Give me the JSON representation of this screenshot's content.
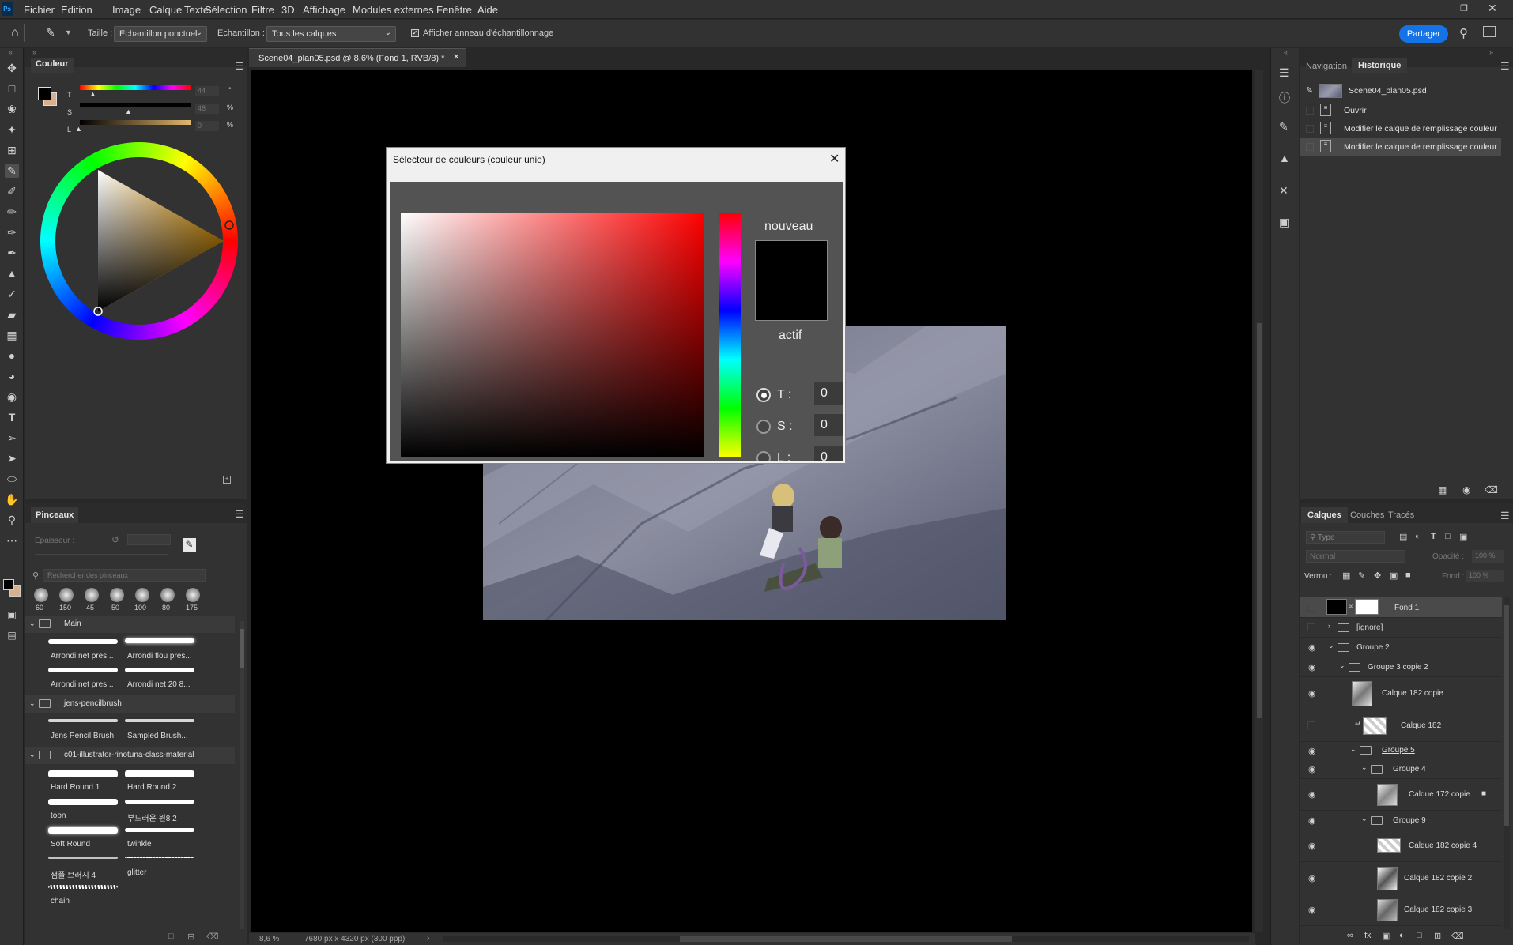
{
  "menubar": {
    "logo": "Ps",
    "items": [
      "Fichier",
      "Edition",
      "Image",
      "Calque",
      "Texte",
      "Sélection",
      "Filtre",
      "3D",
      "Affichage",
      "Modules externes",
      "Fenêtre",
      "Aide"
    ]
  },
  "options": {
    "taille_label": "Taille :",
    "taille_value": "Echantillon ponctuel",
    "echantillon_label": "Echantillon :",
    "echantillon_value": "Tous les calques",
    "checkbox_label": "Afficher anneau d'échantillonnage",
    "share_label": "Partager"
  },
  "color_panel": {
    "tab": "Couleur",
    "slider_labels": [
      "T",
      "S",
      "L"
    ],
    "slider_values": [
      "44",
      "48",
      "0"
    ],
    "slider_units": [
      "°",
      "%",
      "%"
    ]
  },
  "brush_panel": {
    "tab": "Pinceaux",
    "size_label": "Epaisseur :",
    "search_placeholder": "Rechercher des pinceaux",
    "preset_sizes": [
      "60",
      "150",
      "45",
      "50",
      "100",
      "80",
      "175"
    ],
    "groups": [
      {
        "name": "Main",
        "brushes": [
          "Arrondi net pres...",
          "Arrondi flou pres...",
          "Arrondi net pres...",
          "Arrondi net 20 8..."
        ]
      },
      {
        "name": "jens-pencilbrush",
        "brushes": [
          "Jens Pencil Brush",
          "Sampled Brush..."
        ]
      },
      {
        "name": "c01-illustrator-rinotuna-class-material",
        "brushes": [
          "Hard Round 1",
          "Hard Round 2",
          "toon",
          "부드러운 원8 2",
          "Soft Round",
          "twinkle",
          "샘플 브러시 4",
          "glitter",
          "chain"
        ]
      }
    ]
  },
  "document": {
    "tab_title": "Scene04_plan05.psd @ 8,6% (Fond 1, RVB/8) *",
    "zoom": "8,6 %",
    "size_info": "7680 px x 4320 px (300 ppp)"
  },
  "dialog": {
    "title": "Sélecteur de couleurs (couleur unie)",
    "new_label": "nouveau",
    "current_label": "actif",
    "fields": [
      {
        "label": "T :",
        "value": "0"
      },
      {
        "label": "S :",
        "value": "0"
      },
      {
        "label": "L :",
        "value": "0"
      }
    ]
  },
  "history_panel": {
    "tabs": [
      "Navigation",
      "Historique"
    ],
    "snapshot": "Scene04_plan05.psd",
    "states": [
      "Ouvrir",
      "Modifier le calque de remplissage couleur",
      "Modifier le calque de remplissage couleur"
    ]
  },
  "layers_panel": {
    "tabs": [
      "Calques",
      "Couches",
      "Tracés"
    ],
    "filter_placeholder": "Type",
    "blend_mode": "Normal",
    "opacity_label": "Opacité :",
    "opacity_value": "100 %",
    "lock_label": "Verrou :",
    "fill_label": "Fond :",
    "fill_value": "100 %",
    "layers": [
      {
        "name": "Fond 1",
        "kind": "fill",
        "visible": false
      },
      {
        "name": "[ignore]",
        "kind": "group",
        "visible": false
      },
      {
        "name": "Groupe 2",
        "kind": "group",
        "visible": true
      },
      {
        "name": "Groupe 3 copie 2",
        "kind": "group",
        "visible": true
      },
      {
        "name": "Calque 182 copie",
        "kind": "layer",
        "visible": true
      },
      {
        "name": "Calque 182",
        "kind": "layer",
        "visible": false
      },
      {
        "name": "Groupe 5",
        "kind": "group",
        "visible": true
      },
      {
        "name": "Groupe 4",
        "kind": "group",
        "visible": true
      },
      {
        "name": "Calque 172 copie",
        "kind": "layer",
        "visible": true
      },
      {
        "name": "Groupe 9",
        "kind": "group",
        "visible": true
      },
      {
        "name": "Calque 182 copie 4",
        "kind": "layer",
        "visible": true
      },
      {
        "name": "Calque 182 copie 2",
        "kind": "layer",
        "visible": true
      },
      {
        "name": "Calque 182 copie 3",
        "kind": "layer",
        "visible": true
      }
    ]
  },
  "colors": {
    "accent": "#1473e6",
    "panel": "#323232",
    "canvas": "#000000",
    "foreground": "#000000",
    "background_swatch": "#d9b08c"
  }
}
